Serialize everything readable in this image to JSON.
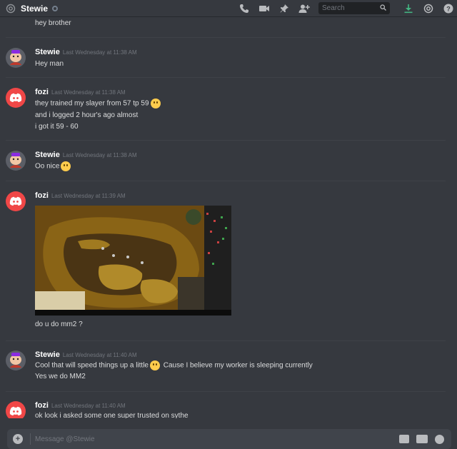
{
  "header": {
    "title": "Stewie",
    "search_placeholder": "Search",
    "icons": [
      "at-icon",
      "status-icon",
      "phone-call-icon",
      "video-icon",
      "pin-icon",
      "add-friend-icon",
      "search-icon",
      "download-icon",
      "mention-icon",
      "help-icon"
    ],
    "accent_download": "#43b581"
  },
  "messages": [
    {
      "author": "",
      "timestamp": "",
      "lines": [
        "hey brother"
      ]
    },
    {
      "author": "Stewie",
      "timestamp": "Last Wednesday at 11:38 AM",
      "lines": [
        "Hey man"
      ]
    },
    {
      "author": "fozi",
      "timestamp": "Last Wednesday at 11:38 AM",
      "lines": [
        "they trained my slayer from 57 tp 59",
        "and i logged 2 hour's ago almost",
        "i got it 59 - 60"
      ]
    },
    {
      "author": "Stewie",
      "timestamp": "Last Wednesday at 11:38 AM",
      "lines": [
        "Oo nice"
      ]
    },
    {
      "author": "fozi",
      "timestamp": "Last Wednesday at 11:39 AM",
      "lines": [
        "do u do mm2 ?"
      ]
    },
    {
      "author": "Stewie",
      "timestamp": "Last Wednesday at 11:40 AM",
      "lines": [
        "Cool that will speed things up a little",
        "Cause I believe my worker is sleeping currently",
        "Yes we do MM2"
      ]
    },
    {
      "author": "fozi",
      "timestamp": "Last Wednesday at 11:40 AM",
      "lines": [
        "ok look i asked some one super trusted on sythe"
      ]
    }
  ],
  "composer": {
    "placeholder": "Message @Stewie"
  }
}
